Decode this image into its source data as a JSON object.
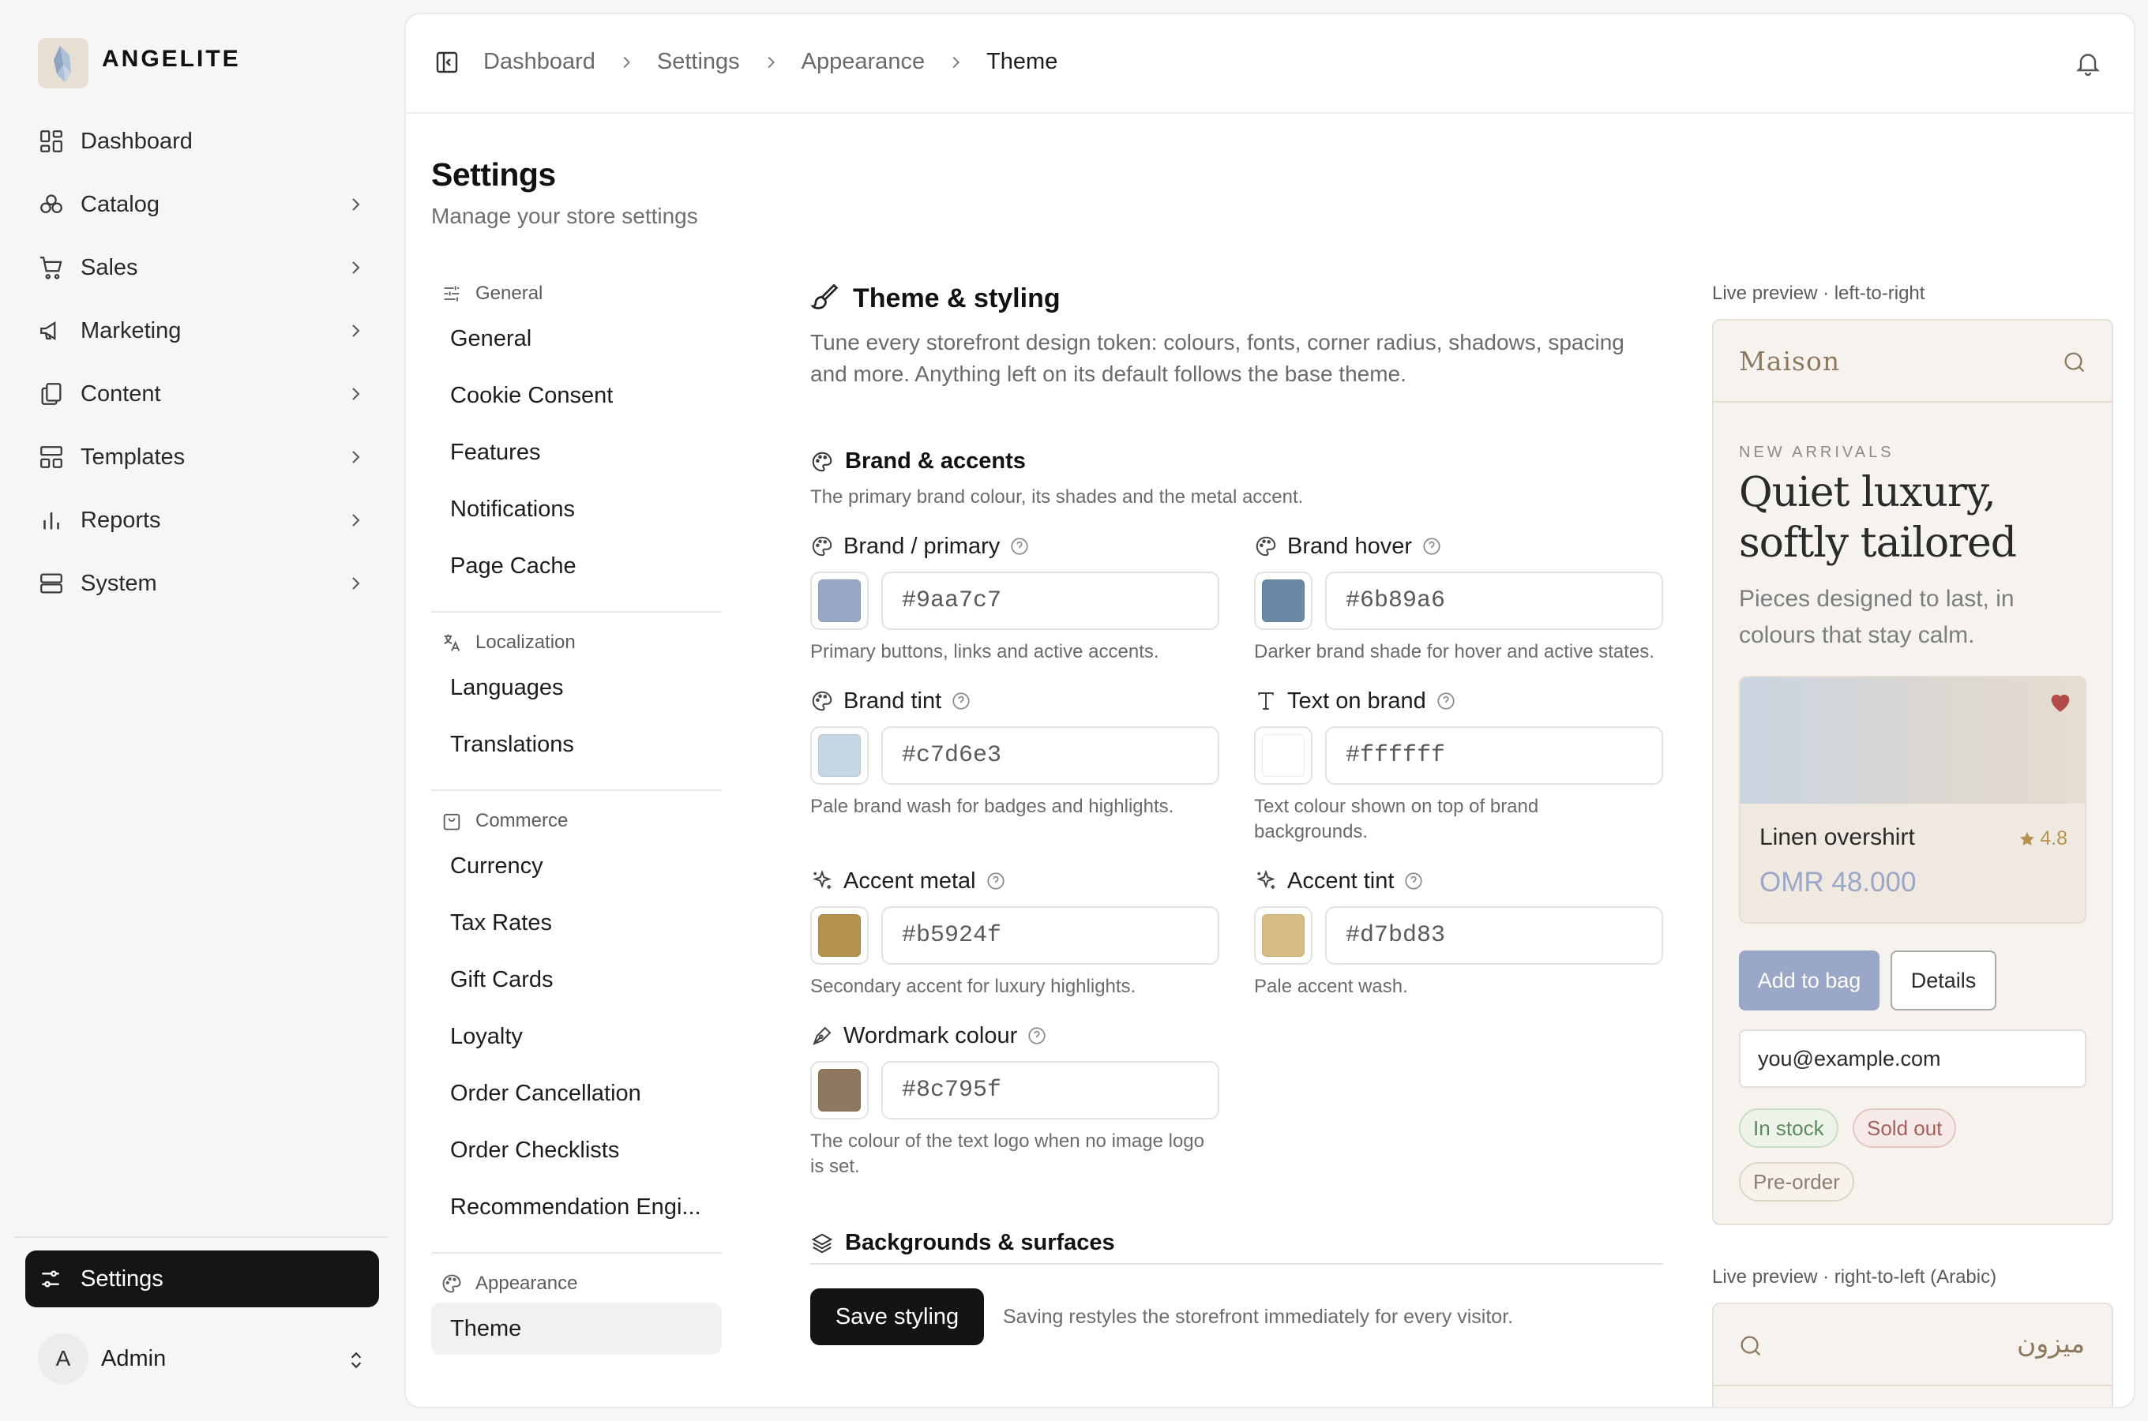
{
  "app": {
    "name": "ANGELITE"
  },
  "sidebar": {
    "items": [
      {
        "label": "Dashboard",
        "icon": "dashboard-icon"
      },
      {
        "label": "Catalog",
        "icon": "catalog-icon"
      },
      {
        "label": "Sales",
        "icon": "cart-icon"
      },
      {
        "label": "Marketing",
        "icon": "megaphone-icon"
      },
      {
        "label": "Content",
        "icon": "content-icon"
      },
      {
        "label": "Templates",
        "icon": "templates-icon"
      },
      {
        "label": "Reports",
        "icon": "reports-icon"
      },
      {
        "label": "System",
        "icon": "server-icon"
      }
    ],
    "settings_label": "Settings",
    "user": {
      "initial": "A",
      "name": "Admin"
    }
  },
  "breadcrumb": [
    "Dashboard",
    "Settings",
    "Appearance",
    "Theme"
  ],
  "page": {
    "title": "Settings",
    "subtitle": "Manage your store settings"
  },
  "settings_nav": {
    "groups": [
      {
        "heading": "General",
        "items": [
          "General",
          "Cookie Consent",
          "Features",
          "Notifications",
          "Page Cache"
        ]
      },
      {
        "heading": "Localization",
        "items": [
          "Languages",
          "Translations"
        ]
      },
      {
        "heading": "Commerce",
        "items": [
          "Currency",
          "Tax Rates",
          "Gift Cards",
          "Loyalty",
          "Order Cancellation",
          "Order Checklists",
          "Recommendation Engi..."
        ]
      },
      {
        "heading": "Appearance",
        "items": [
          "Theme"
        ]
      }
    ],
    "active": "Theme"
  },
  "theme": {
    "title": "Theme & styling",
    "description": "Tune every storefront design token: colours, fonts, corner radius, shadows, spacing and more. Anything left on its default follows the base theme.",
    "brand_section": {
      "title": "Brand & accents",
      "description": "The primary brand colour, its shades and the metal accent."
    },
    "fields": [
      {
        "label": "Brand / primary",
        "value": "#9aa7c7",
        "help": "Primary buttons, links and active accents.",
        "icon": "palette-icon"
      },
      {
        "label": "Brand hover",
        "value": "#6b89a6",
        "help": "Darker brand shade for hover and active states.",
        "icon": "palette-icon"
      },
      {
        "label": "Brand tint",
        "value": "#c7d6e3",
        "help": "Pale brand wash for badges and highlights.",
        "icon": "palette-icon"
      },
      {
        "label": "Text on brand",
        "value": "#ffffff",
        "help": "Text colour shown on top of brand backgrounds.",
        "icon": "type-icon"
      },
      {
        "label": "Accent metal",
        "value": "#b5924f",
        "help": "Secondary accent for luxury highlights.",
        "icon": "sparkle-icon"
      },
      {
        "label": "Accent tint",
        "value": "#d7bd83",
        "help": "Pale accent wash.",
        "icon": "sparkle-icon"
      },
      {
        "label": "Wordmark colour",
        "value": "#8c795f",
        "help": "The colour of the text logo when no image logo is set.",
        "icon": "pen-icon"
      }
    ],
    "backgrounds_section": {
      "title": "Backgrounds & surfaces"
    },
    "save_label": "Save styling",
    "save_note": "Saving restyles the storefront immediately for every visitor."
  },
  "preview": {
    "ltr_label": "Live preview · left-to-right",
    "rtl_label": "Live preview · right-to-left (Arabic)",
    "logo": "Maison",
    "rtl_logo": "ميزون",
    "kicker": "NEW ARRIVALS",
    "headline": "Quiet luxury, softly tailored",
    "text": "Pieces designed to last, in colours that stay calm.",
    "product": {
      "name": "Linen overshirt",
      "rating": "4.8",
      "price": "OMR 48.000"
    },
    "add_label": "Add to bag",
    "details_label": "Details",
    "email_value": "you@example.com",
    "badges": [
      "In stock",
      "Sold out",
      "Pre-order"
    ]
  },
  "colors": {
    "accent": "#9aa7c7",
    "dark": "#141414",
    "gold": "#b5924f"
  }
}
